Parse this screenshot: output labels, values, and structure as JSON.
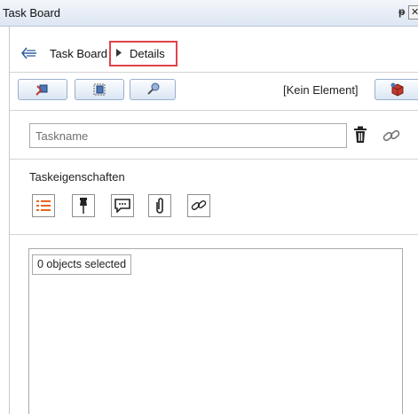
{
  "window": {
    "title": "Task Board",
    "pin_glyph": "ᵽ",
    "close_glyph": "✕"
  },
  "breadcrumb": {
    "back_icon": "back-arrow-icon",
    "root": "Task Board",
    "separator_icon": "triangle-right-icon",
    "current": "Details"
  },
  "toolbar": {
    "buttons": [
      "edit-element-icon",
      "select-element-icon",
      "pick-element-icon"
    ],
    "element_status": "[Kein Element]",
    "right_button_icon": "3d-element-icon"
  },
  "task": {
    "name_placeholder": "Taskname",
    "name_value": "",
    "delete_icon": "trash-icon",
    "link_icon": "link-icon"
  },
  "properties": {
    "label": "Taskeigenschaften",
    "tools": [
      "list-icon",
      "pin-icon",
      "comment-icon",
      "attachment-icon",
      "link-icon"
    ]
  },
  "objects": {
    "selection_status": "0 objects selected"
  },
  "colors": {
    "accent_orange": "#e8651a",
    "highlight_red": "#e0434b",
    "title_bar": "#dce6f3"
  }
}
